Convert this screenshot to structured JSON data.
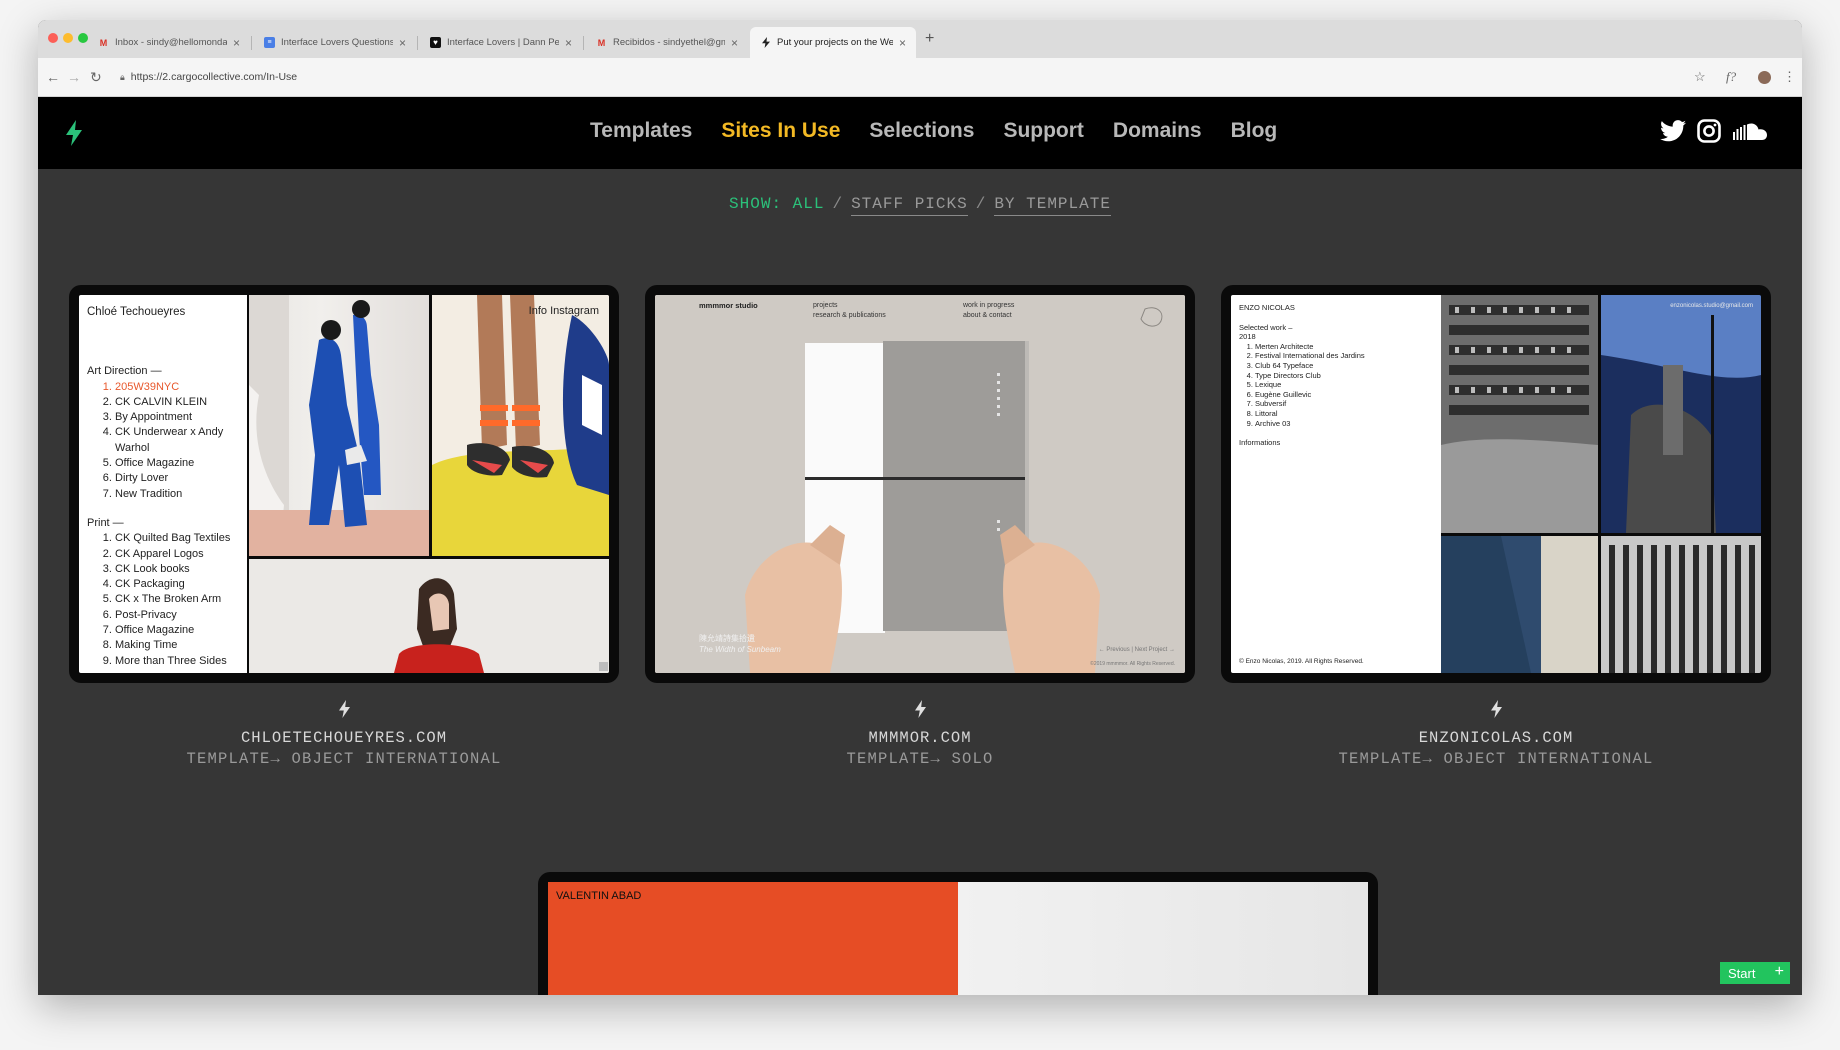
{
  "browser": {
    "tabs": [
      {
        "title": "Inbox - sindy@hellomonday.cc",
        "icon": "gmail-icon"
      },
      {
        "title": "Interface Lovers Questions - S",
        "icon": "docs-icon"
      },
      {
        "title": "Interface Lovers | Dann Petty",
        "icon": "heart-icon"
      },
      {
        "title": "Recibidos - sindyethel@gmail",
        "icon": "gmail-icon"
      },
      {
        "title": "Put your projects on the Web.",
        "icon": "bolt-icon"
      }
    ],
    "url": "https://2.cargocollective.com/In-Use"
  },
  "nav": {
    "items": [
      "Templates",
      "Sites In Use",
      "Selections",
      "Support",
      "Domains",
      "Blog"
    ],
    "active": "Sites In Use",
    "social": [
      "twitter-icon",
      "instagram-icon",
      "soundcloud-icon"
    ]
  },
  "filter": {
    "label": "SHOW: ALL",
    "options": [
      "STAFF PICKS",
      "BY TEMPLATE"
    ]
  },
  "sites": [
    {
      "domain": "CHLOETECHOUEYRES.COM",
      "template": "TEMPLATE→ OBJECT INTERNATIONAL",
      "preview": {
        "name": "Chloé Techoueyres",
        "links": "Info  Instagram",
        "section1": "Art Direction —",
        "list1": [
          "205W39NYC",
          "CK CALVIN KLEIN",
          "By Appointment",
          "CK Underwear x Andy Warhol",
          "Office Magazine",
          "Dirty Lover",
          "New Tradition"
        ],
        "section2": "Print —",
        "list2": [
          "CK Quilted Bag Textiles",
          "CK Apparel Logos",
          "CK Look books",
          "CK Packaging",
          "CK x The Broken Arm",
          "Post-Privacy",
          "Office Magazine",
          "Making Time",
          "More than Three Sides"
        ]
      }
    },
    {
      "domain": "MMMMOR.COM",
      "template": "TEMPLATE→ SOLO",
      "preview": {
        "studio": "mmmmor studio",
        "col1": [
          "projects",
          "research & publications"
        ],
        "col2": [
          "work in progress",
          "about & contact"
        ],
        "caption_cn": "陳允靖詩集拾遺",
        "caption_en": "The Width of Sunbeam",
        "caption_year": "",
        "pager": "← Previous   |   Next Project →",
        "copyright": "©2019 mmmmor. All Rights Reserved."
      }
    },
    {
      "domain": "ENZONICOLAS.COM",
      "template": "TEMPLATE→ OBJECT INTERNATIONAL",
      "preview": {
        "name": "ENZO NICOLAS",
        "selected": "Selected work –",
        "year": "2018",
        "list": [
          "Merten Architecte",
          "Festival International des Jardins",
          "Club 64 Typeface",
          "Type Directors Club",
          "Lexique",
          "Eugène Guillevic",
          "Subversif",
          "Littoral",
          "Archive 03"
        ],
        "info": "Informations",
        "footer": "© Enzo Nicolas, 2019. All Rights Reserved.",
        "email": "enzonicolas.studio@gmail.com"
      }
    },
    {
      "preview": {
        "name": "VALENTIN ABAD"
      }
    }
  ],
  "start_button": "Start"
}
